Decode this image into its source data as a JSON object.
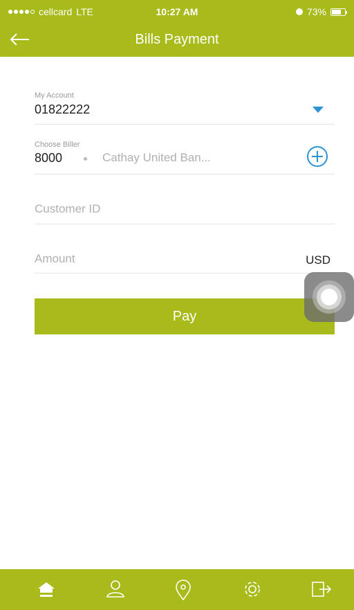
{
  "status_bar": {
    "carrier": "cellcard",
    "network": "LTE",
    "time": "10:27 AM",
    "battery_percent": "73%",
    "battery_level": 0.73
  },
  "header": {
    "title": "Bills Payment",
    "back_icon": "arrow-left-icon"
  },
  "form": {
    "account": {
      "label": "My Account",
      "value": "01822222"
    },
    "biller": {
      "label": "Choose Biller",
      "code": "8000",
      "name": "Cathay United Ban..."
    },
    "customer_id": {
      "placeholder": "Customer ID"
    },
    "amount": {
      "placeholder": "Amount",
      "currency": "USD"
    },
    "pay_label": "Pay"
  },
  "tabbar": {
    "items": [
      {
        "icon": "home-icon"
      },
      {
        "icon": "user-icon"
      },
      {
        "icon": "location-icon"
      },
      {
        "icon": "settings-icon"
      },
      {
        "icon": "logout-icon"
      }
    ]
  },
  "colors": {
    "brand": "#a9ba1b",
    "accent": "#2a93d5"
  }
}
